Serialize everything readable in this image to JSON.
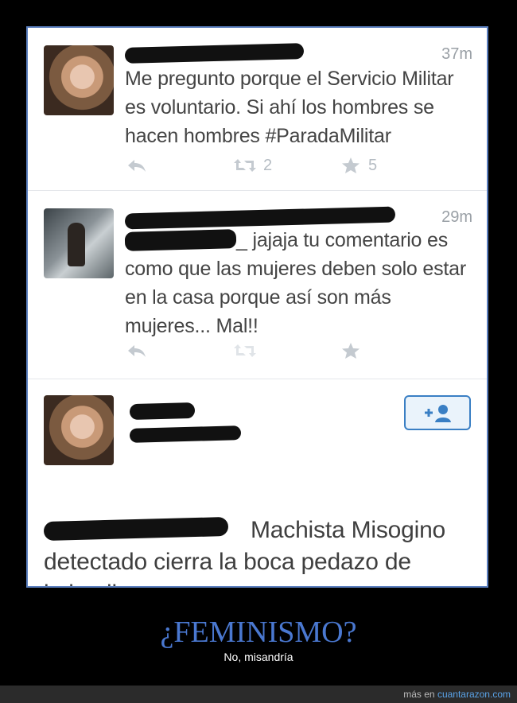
{
  "tweets": [
    {
      "time": "37m",
      "text": "Me pregunto porque el Servicio Militar es voluntario. Si ahí los hombres se hacen hombres #ParadaMilitar",
      "retweets": "2",
      "favorites": "5"
    },
    {
      "time": "29m",
      "mention_tail": "_",
      "text": "jajaja tu comentario es como que las mujeres deben solo estar en la casa porque así son más mujeres...  Mal!!",
      "retweets": "",
      "favorites": ""
    },
    {
      "text": "Machista Misogino detectado cierra la boca pedazo de imbecil"
    }
  ],
  "caption": "¿FEMINISMO?",
  "subcaption": "No, misandría",
  "footer": {
    "prefix": "más en ",
    "link": "cuantarazon.com"
  },
  "icons": [
    "reply-icon",
    "retweet-icon",
    "star-icon",
    "follow-user-icon"
  ],
  "colors": {
    "frame_border": "#5b7fbf",
    "caption": "#4a78d0",
    "follow_button": "#3a7fc4"
  }
}
